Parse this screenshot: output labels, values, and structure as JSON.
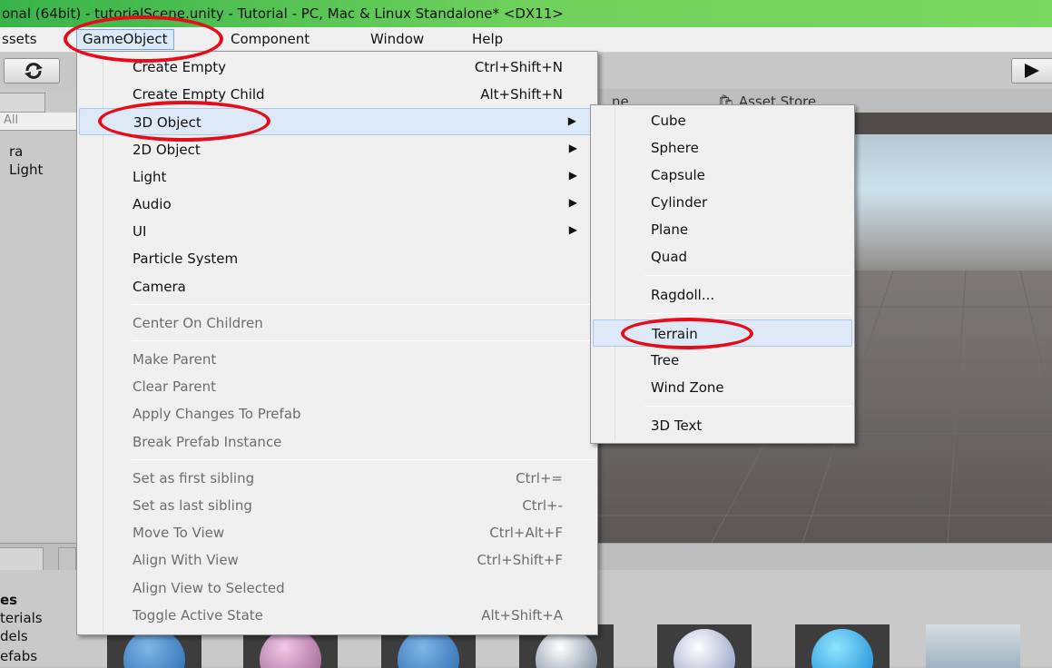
{
  "window": {
    "title": "onal (64bit) - tutorialScene.unity - Tutorial - PC, Mac & Linux Standalone* <DX11>"
  },
  "menubar": {
    "items": [
      "ssets",
      "GameObject",
      "Component",
      "Window",
      "Help"
    ],
    "active": "GameObject"
  },
  "toolbar": {
    "play_icon": "play-icon",
    "refresh_icon": "refresh-icon"
  },
  "hierarchy": {
    "search_value": "All",
    "items": [
      "ra",
      "Light"
    ]
  },
  "scene_tabs": {
    "partial_tab": "ne",
    "asset_store": "Asset Store",
    "asset_store_icon": "shopping-bag-icon"
  },
  "project": {
    "folders": [
      "es",
      "terials",
      "dels",
      "efabs"
    ]
  },
  "gameobject_menu": {
    "groups": [
      [
        {
          "label": "Create Empty",
          "shortcut": "Ctrl+Shift+N"
        },
        {
          "label": "Create Empty Child",
          "shortcut": "Alt+Shift+N"
        },
        {
          "label": "3D Object",
          "submenu": true,
          "highlighted": true
        },
        {
          "label": "2D Object",
          "submenu": true
        },
        {
          "label": "Light",
          "submenu": true
        },
        {
          "label": "Audio",
          "submenu": true
        },
        {
          "label": "UI",
          "submenu": true
        },
        {
          "label": "Particle System"
        },
        {
          "label": "Camera"
        }
      ],
      [
        {
          "label": "Center On Children",
          "disabled": true
        }
      ],
      [
        {
          "label": "Make Parent",
          "disabled": true
        },
        {
          "label": "Clear Parent",
          "disabled": true
        },
        {
          "label": "Apply Changes To Prefab",
          "disabled": true
        },
        {
          "label": "Break Prefab Instance",
          "disabled": true
        }
      ],
      [
        {
          "label": "Set as first sibling",
          "shortcut": "Ctrl+=",
          "disabled": true
        },
        {
          "label": "Set as last sibling",
          "shortcut": "Ctrl+-",
          "disabled": true
        },
        {
          "label": "Move To View",
          "shortcut": "Ctrl+Alt+F",
          "disabled": true
        },
        {
          "label": "Align With View",
          "shortcut": "Ctrl+Shift+F",
          "disabled": true
        },
        {
          "label": "Align View to Selected",
          "disabled": true
        },
        {
          "label": "Toggle Active State",
          "shortcut": "Alt+Shift+A",
          "disabled": true
        }
      ]
    ]
  },
  "object3d_submenu": {
    "groups": [
      [
        {
          "label": "Cube"
        },
        {
          "label": "Sphere"
        },
        {
          "label": "Capsule"
        },
        {
          "label": "Cylinder"
        },
        {
          "label": "Plane"
        },
        {
          "label": "Quad"
        }
      ],
      [
        {
          "label": "Ragdoll..."
        }
      ],
      [
        {
          "label": "Terrain",
          "highlighted": true
        },
        {
          "label": "Tree"
        },
        {
          "label": "Wind Zone"
        }
      ],
      [
        {
          "label": "3D Text"
        }
      ]
    ]
  },
  "annotation_color": "#e60d1a"
}
